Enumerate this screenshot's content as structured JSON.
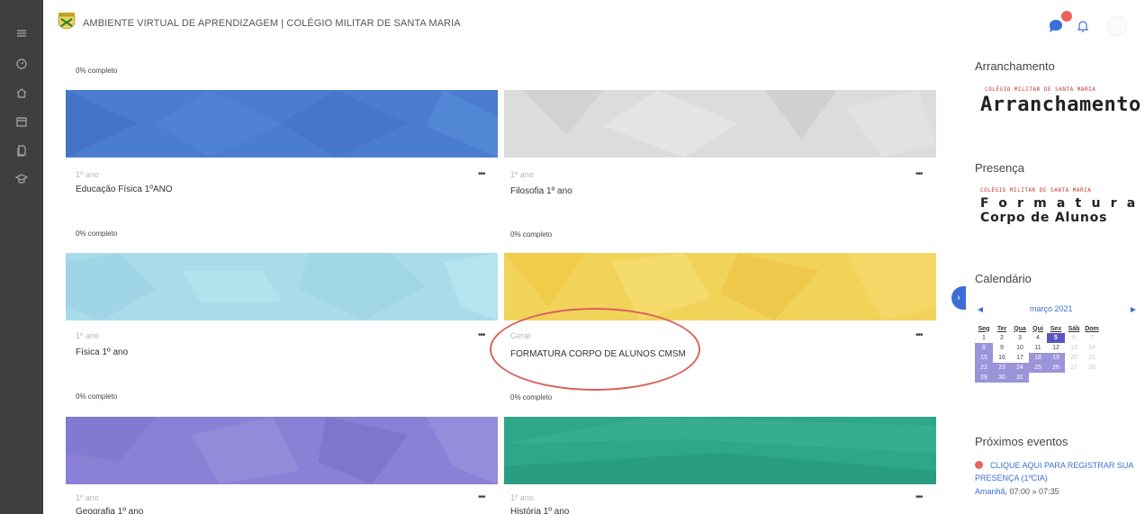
{
  "header": {
    "site_title": "AMBIENTE VIRTUAL DE APRENDIZAGEM | COLÉGIO MILITAR DE SANTA MARIA"
  },
  "nav": {
    "icons": [
      "dashboard-icon",
      "home-icon",
      "calendar-icon",
      "files-icon",
      "graduation-cap-icon"
    ]
  },
  "courses": [
    {
      "progress": "0% completo",
      "category": "",
      "name": "",
      "color": "#6a6ac8"
    },
    {
      "progress": "",
      "category": "1º ano",
      "name": "Educação Física 1ºANO",
      "color": "#4a7ccf"
    },
    {
      "progress": "0% completo",
      "category": "1º ano",
      "name": "Filosofia 1º ano",
      "color": "#dcdcdc"
    },
    {
      "progress": "0% completo",
      "category": "1º ano",
      "name": "Física 1º ano",
      "color": "#a8dcea"
    },
    {
      "progress": "0% completo",
      "category": "Geral",
      "name": "FORMATURA CORPO DE ALUNOS CMSM",
      "color": "#f2d35a"
    },
    {
      "progress": "0% completo",
      "category": "1º ano",
      "name": "Geografia 1º ano",
      "color": "#8a80d6"
    },
    {
      "progress": "0% completo",
      "category": "1º ano",
      "name": "História 1º ano",
      "color": "#2ea68a"
    }
  ],
  "menu_glyph": "•••",
  "blocks": {
    "arranchamento": {
      "title": "Arranchamento",
      "banner_small": "COLÉGIO MILITAR DE SANTA MARIA",
      "banner_big": "Arranchamento"
    },
    "presenca": {
      "title": "Presença",
      "banner_small": "COLÉGIO MILITAR DE SANTA MARIA",
      "banner_line1": "Formatura",
      "banner_line2": "Corpo de Alunos"
    },
    "calendario": {
      "title": "Calendário",
      "prev": "◄",
      "next": "►",
      "month": "março 2021",
      "weekdays": [
        "Seg",
        "Ter",
        "Qua",
        "Qui",
        "Sex",
        "Sáb",
        "Dom"
      ],
      "weeks": [
        [
          "1",
          "2",
          "3",
          "4",
          "5",
          "6",
          "7"
        ],
        [
          "8",
          "9",
          "10",
          "11",
          "12",
          "13",
          "14"
        ],
        [
          "15",
          "16",
          "17",
          "18",
          "19",
          "20",
          "21"
        ],
        [
          "22",
          "23",
          "24",
          "25",
          "26",
          "27",
          "28"
        ],
        [
          "29",
          "30",
          "31",
          "",
          "",
          "",
          ""
        ]
      ],
      "event_days": [
        "8",
        "15",
        "18",
        "19",
        "22",
        "23",
        "24",
        "25",
        "26",
        "29",
        "30",
        "31"
      ],
      "today": "5"
    },
    "eventos": {
      "title": "Próximos eventos",
      "event_link": "CLIQUE AQUI PARA REGISTRAR SUA PRESENÇA (1ºCIA)",
      "event_day": "Amanhã",
      "event_time": ", 07:00 » 07:35"
    }
  },
  "colors": {
    "accent": "#3d6ed6",
    "nav_bg": "#3f3f3f",
    "notification": "#e8655a",
    "highlight": "#d9615a"
  }
}
